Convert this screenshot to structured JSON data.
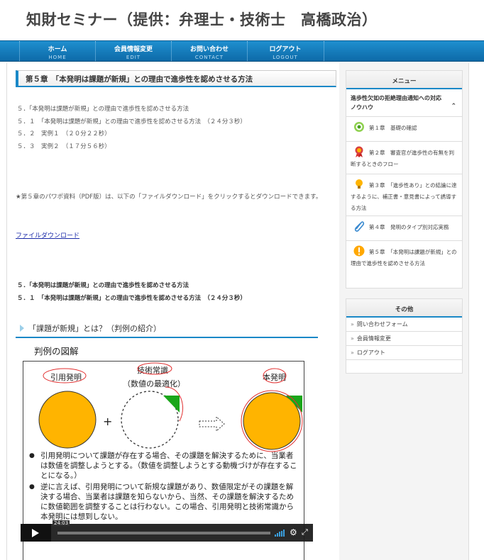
{
  "site": {
    "title": "知財セミナー（提供：弁理士・技術士　高橋政治）"
  },
  "nav": [
    {
      "jp": "ホーム",
      "en": "HOME"
    },
    {
      "jp": "会員情報変更",
      "en": "EDIT"
    },
    {
      "jp": "お問い合わせ",
      "en": "CONTACT"
    },
    {
      "jp": "ログアウト",
      "en": "LOGOUT"
    }
  ],
  "main": {
    "chapter_title": "第５章　「本発明は課題が新規」との理由で進歩性を認めさせる方法",
    "toc": [
      "５．「本発明は課題が新規」との理由で進歩性を認めさせる方法",
      "５．１　「本発明は課題が新規」との理由で進歩性を認めさせる方法　（２４分３秒）",
      "５．２　実例１　（２０分２２秒）",
      "５．３　実例２　（１７分５６秒）"
    ],
    "note": "★第５章のパワポ資料（PDF版）は、以下の「ファイルダウンロード」をクリックするとダウンロードできます。",
    "download_link": "ファイルダウンロード",
    "bold_list": [
      "５．「本発明は課題が新規」との理由で進歩性を認めさせる方法",
      "５．１　「本発明は課題が新規」との理由で進歩性を認めさせる方法　（２４分３秒）"
    ],
    "section_title": "「課題が新規」とは？（判例の紹介）",
    "slide": {
      "heading": "判例の図解",
      "label_prior": "引用発明",
      "label_common": "技術常識",
      "label_common_sub": "（数値の最適化）",
      "label_invention": "本発明",
      "plus": "+",
      "bullets": [
        "引用発明について課題が存在する場合、その課題を解決するために、当業者は数値を調整しようとする。（数値を調整しようとする動機づけが存在することになる。）",
        "逆に言えば、引用発明について新規な課題があり、数値限定がその課題を解決する場合、当業者は課題を知らないから、当然、その課題を解決するために数値範囲を調整することは行わない。この場合、引用発明と技術常識から本発明には想到しない。"
      ]
    },
    "player": {
      "time": "24:03"
    }
  },
  "sidebar": {
    "menu_title": "メニュー",
    "menu_top": "進歩性欠如の拒絶理由通知への対応ノウハウ",
    "menu_items": [
      {
        "text": "第１章　基礎の確認",
        "icon": "target-icon"
      },
      {
        "text": "第２章　審査官が進歩性の有無を判断するときのフロー",
        "icon": "medal-icon"
      },
      {
        "text": "第３章　「進歩性あり」との結論に達するように、補正書・意見書によって誘導する方法",
        "icon": "lightbulb-icon"
      },
      {
        "text": "第４章　発明のタイプ別対応実務",
        "icon": "paperclip-icon"
      },
      {
        "text": "第５章　「本発明は課題が新規」との理由で進歩性を認めさせる方法",
        "icon": "exclamation-icon"
      }
    ],
    "other_title": "その他",
    "other_items": [
      "問い合わせフォーム",
      "会員情報変更",
      "ログアウト"
    ]
  },
  "colors": {
    "accent": "#1a88c7",
    "nav_bg": "#1479ba",
    "circle_fill": "#ffb400",
    "wedge_green": "#1aa61a",
    "annotation_red": "#e23030"
  }
}
